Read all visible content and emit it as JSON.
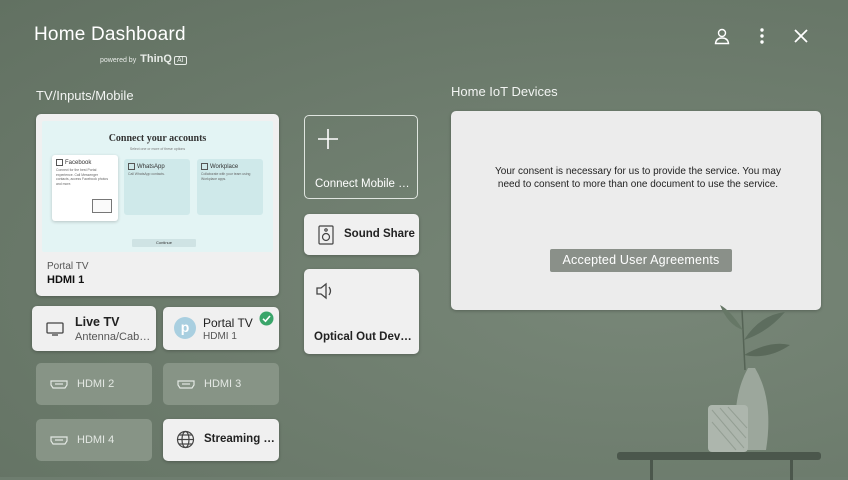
{
  "header": {
    "title": "Home Dashboard",
    "powered_by": "powered by",
    "brand": "ThinQ",
    "brand_badge": "AI",
    "icons": [
      "user-icon",
      "more-vertical-icon",
      "close-icon"
    ]
  },
  "tv_section": {
    "title": "TV/Inputs/Mobile",
    "preview": {
      "screen_title": "Connect your accounts",
      "screen_subtitle": "Select one or more of these options",
      "accounts": [
        {
          "name": "Facebook",
          "desc": "Connect for the best Portal experience. Call Messenger contacts, access Facebook photos and more."
        },
        {
          "name": "WhatsApp",
          "desc": "Call WhatsApp contacts."
        },
        {
          "name": "Workplace",
          "desc": "Collaborate with your team using Workplace apps."
        }
      ],
      "continue_label": "Continue",
      "source": "Portal TV",
      "input": "HDMI 1"
    },
    "inputs": [
      {
        "label": "Live TV",
        "sub": "Antenna/Cab…",
        "icon": "tv-icon"
      },
      {
        "label": "Portal TV",
        "sub": "HDMI 1",
        "icon": "portal-avatar-icon",
        "avatar_letter": "p",
        "connected": true
      },
      {
        "label": "HDMI 2",
        "icon": "hdmi-icon"
      },
      {
        "label": "HDMI 3",
        "icon": "hdmi-icon"
      },
      {
        "label": "HDMI 4",
        "icon": "hdmi-icon"
      },
      {
        "label": "Streaming …",
        "icon": "globe-icon"
      }
    ],
    "mobile": [
      {
        "label": "Connect Mobile …",
        "icon": "plus-icon"
      },
      {
        "label": "Sound Share",
        "icon": "speaker-icon"
      },
      {
        "label": "Optical Out Dev…",
        "icon": "volume-icon"
      }
    ]
  },
  "iot_section": {
    "title": "Home IoT Devices",
    "consent_text": "Your consent is necessary for us to provide the service. You may need to consent to more than one document to use the service.",
    "button_label": "Accepted User Agreements"
  },
  "colors": {
    "background": "#6e7d6f",
    "card": "#f0f0f0",
    "dim_card": "#879486",
    "accent_check": "#3aa56a",
    "button": "#8a9089"
  }
}
